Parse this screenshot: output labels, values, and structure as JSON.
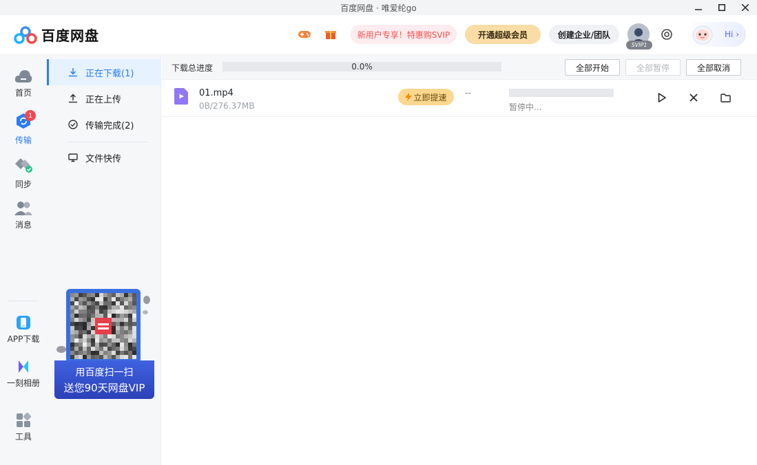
{
  "window": {
    "title": "百度网盘 · 唯爱纶go"
  },
  "header": {
    "app_name": "百度网盘",
    "game_icon": "gamepad-icon",
    "gift_icon": "gift-icon",
    "promo_label": "新用户专享！特惠购SVIP",
    "vip_label": "开通超级会员",
    "team_label": "创建企业/团队",
    "svip_tag": "SVIP1",
    "hi_label": "Hi ›"
  },
  "leftnav": {
    "items": [
      {
        "label": "首页",
        "icon": "cloud-home-icon"
      },
      {
        "label": "传输",
        "icon": "transfer-icon",
        "badge": "1"
      },
      {
        "label": "同步",
        "icon": "sync-icon"
      },
      {
        "label": "消息",
        "icon": "users-icon"
      },
      {
        "label": "APP下载",
        "icon": "phone-icon"
      },
      {
        "label": "一刻相册",
        "icon": "album-icon"
      },
      {
        "label": "工具",
        "icon": "tools-icon"
      }
    ]
  },
  "subnav": {
    "items": [
      {
        "label": "正在下载(1)",
        "icon": "download-icon",
        "active": true
      },
      {
        "label": "正在上传",
        "icon": "upload-icon"
      },
      {
        "label": "传输完成(2)",
        "icon": "check-circle-icon"
      },
      {
        "label": "文件快传",
        "icon": "monitor-icon"
      }
    ]
  },
  "promo": {
    "line1": "用百度扫一扫",
    "line2": "送您90天网盘VIP"
  },
  "toolbar": {
    "label": "下载总进度",
    "progress_text": "0.0%",
    "progress_value": 0,
    "start_all": "全部开始",
    "pause_all": "全部暂停",
    "cancel_all": "全部取消"
  },
  "downloads": [
    {
      "name": "01.mp4",
      "size": "0B/276.37MB",
      "speedup_label": "立即提速",
      "speed": "--",
      "progress_value": 0,
      "status": "暂停中..."
    }
  ],
  "colors": {
    "accent": "#2a7cf6",
    "badge": "#f5484e",
    "vip_gold": "#f9dca6",
    "promo_red": "#f2534e"
  }
}
